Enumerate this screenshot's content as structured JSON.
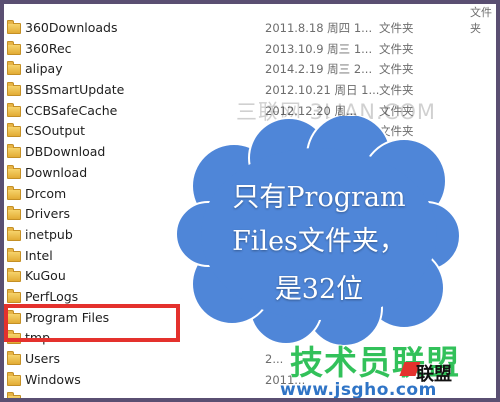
{
  "files": [
    {
      "name": "360Downloads",
      "date": "2011.8.18 周四 1...",
      "type": "文件夹"
    },
    {
      "name": "360Rec",
      "date": "2013.10.9 周三 1...",
      "type": "文件夹"
    },
    {
      "name": "alipay",
      "date": "2014.2.19 周三 2...",
      "type": "文件夹"
    },
    {
      "name": "BSSmartUpdate",
      "date": "2012.10.21 周日 1...",
      "type": "文件夹"
    },
    {
      "name": "CCBSafeCache",
      "date": "2012.12.20 周...",
      "type": "文件夹"
    },
    {
      "name": "CSOutput",
      "date": "2013.3.21...",
      "type": "文件夹"
    },
    {
      "name": "DBDownload",
      "date": "",
      "type": ""
    },
    {
      "name": "Download",
      "date": "",
      "type": ""
    },
    {
      "name": "Drcom",
      "date": "",
      "type": ""
    },
    {
      "name": "Drivers",
      "date": "",
      "type": ""
    },
    {
      "name": "inetpub",
      "date": "",
      "type": ""
    },
    {
      "name": "Intel",
      "date": "",
      "type": ""
    },
    {
      "name": "KuGou",
      "date": "",
      "type": ""
    },
    {
      "name": "PerfLogs",
      "date": "",
      "type": ""
    },
    {
      "name": "Program Files",
      "date": "",
      "type": ""
    },
    {
      "name": "tmp",
      "date": "",
      "type": ""
    },
    {
      "name": "Users",
      "date": "2...",
      "type": ""
    },
    {
      "name": "Windows",
      "date": "2011...",
      "type": ""
    },
    {
      "name": "",
      "date": "",
      "type": ""
    }
  ],
  "top_partial": {
    "type": "文件夹"
  },
  "annotation": {
    "line1": "只有Program",
    "line2": "Files文件夹，",
    "line3": "是32位"
  },
  "watermark": "三联网 3LIAN.COM",
  "logo": {
    "name": "技术员联盟",
    "url": "www.jsgho.com",
    "mark": "联盟"
  },
  "colors": {
    "highlight": "#e4312d",
    "cloud_fill": "#4f86d8",
    "logo_green": "#32c15a",
    "folder": "#e7b445"
  }
}
